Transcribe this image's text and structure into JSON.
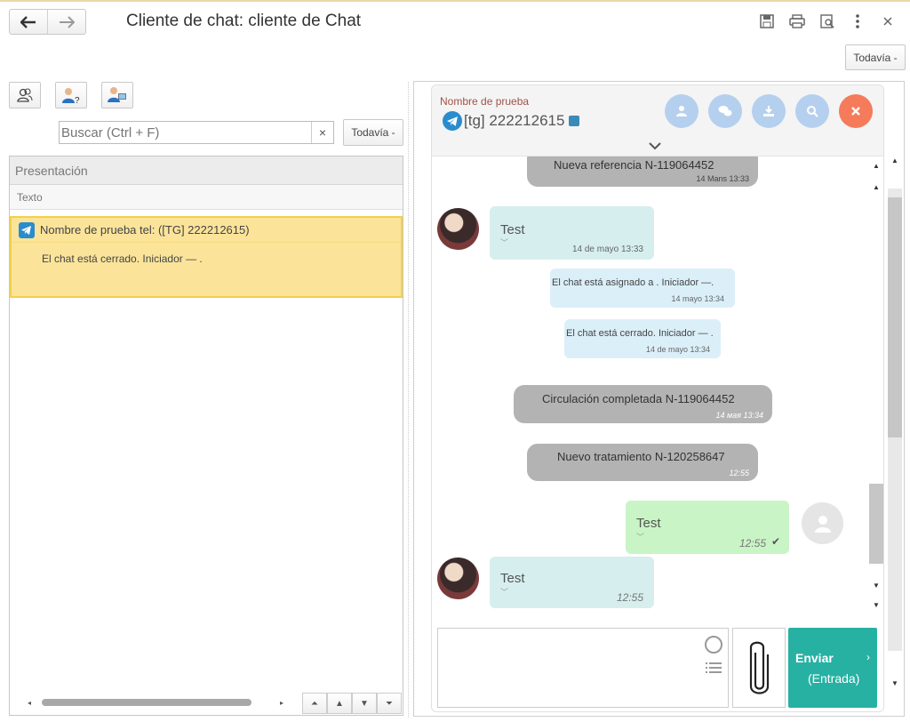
{
  "window": {
    "title": "Cliente de chat: cliente de Chat",
    "back_label": "🡐",
    "forward_label": "🡒",
    "todavia_top": "Todavía -"
  },
  "left": {
    "search_placeholder": "Buscar (Ctrl + F)",
    "clear_label": "×",
    "todavia": "Todavía -",
    "column_header": "Presentación",
    "column_sub": "Texto",
    "item": {
      "title": "Nombre de prueba tel: ([TG] 222212615)",
      "text": "El chat está cerrado. Iniciador  —  ."
    }
  },
  "chat": {
    "contact_name": "Nombre de prueba",
    "contact_phone": "[tg] 222212615",
    "system_messages": [
      {
        "text": "Nueva referencia N-119064452",
        "time": "14 Mans 13:33"
      },
      {
        "text": "Circulación completada N-119064452",
        "time": "14 мая 13:34"
      },
      {
        "text": "Nuevo tratamiento N-120258647",
        "time": "12:55"
      }
    ],
    "incoming_1": {
      "text": "Test",
      "time": "14 de mayo 13:33"
    },
    "info_1": {
      "text": "El chat está asignado a . Iniciador  —.",
      "time": "14 mayo 13:34"
    },
    "info_2": {
      "text": "El chat está cerrado. Iniciador —  .",
      "time": "14 de mayo 13:34"
    },
    "outgoing": {
      "text": "Test",
      "time": "12:55"
    },
    "incoming_2": {
      "text": "Test",
      "time": "12:55"
    },
    "send_label": "Enviar",
    "send_sub": "(Entrada)"
  },
  "colors": {
    "accent": "#27b1a3",
    "selected_item": "#fbe49a",
    "close_button": "#f57b5b"
  }
}
